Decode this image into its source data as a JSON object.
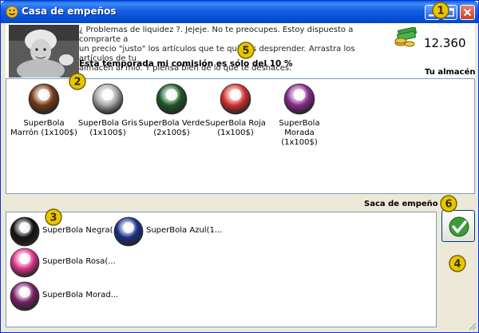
{
  "window": {
    "title": "Casa de empeños"
  },
  "header": {
    "intro_line1": "¿ Problemas de liquidez ?. Jejeje. No te preocupes. Estoy dispuesto a comprarte a",
    "intro_line2": "un precio \"justo\" los artículos que te quieras desprender. Arrastra los artículos de tu",
    "intro_line3": "almacén al mío. Y piensa bien de lo que te deshaces.",
    "commission": "Esta temporada mi comisión es sólo del 10 %",
    "money": "12.360"
  },
  "labels": {
    "warehouse": "Tu almacén",
    "pawn_bag": "Saca de empeño"
  },
  "warehouse_items": [
    {
      "line1": "SuperBola",
      "line2": "Marrón (1x100$)",
      "color": "#7a3a14"
    },
    {
      "line1": "SuperBola Gris",
      "line2": "(1x100$)",
      "color": "#a8a8a8"
    },
    {
      "line1": "SuperBola Verde",
      "line2": "(2x100$)",
      "color": "#1d5a26"
    },
    {
      "line1": "SuperBola Roja",
      "line2": "(1x100$)",
      "color": "#d93030"
    },
    {
      "line1": "SuperBola",
      "line2": "Morada (1x100$)",
      "color": "#8a2a8e"
    }
  ],
  "pawn_items": [
    {
      "label": "SuperBola Negra(...",
      "color": "#111111"
    },
    {
      "label": "SuperBola Azul(1...",
      "color": "#1a2f8a"
    },
    {
      "label": "SuperBola Rosa(...",
      "color": "#e0358f"
    },
    {
      "label": "SuperBola Morad...",
      "color": "#7a1f66"
    }
  ],
  "badges": [
    "1",
    "2",
    "3",
    "4",
    "5",
    "6"
  ],
  "colors": {
    "title_bar": "#0a5be0",
    "badge": "#e8c600",
    "frame": "#ece9d8"
  }
}
